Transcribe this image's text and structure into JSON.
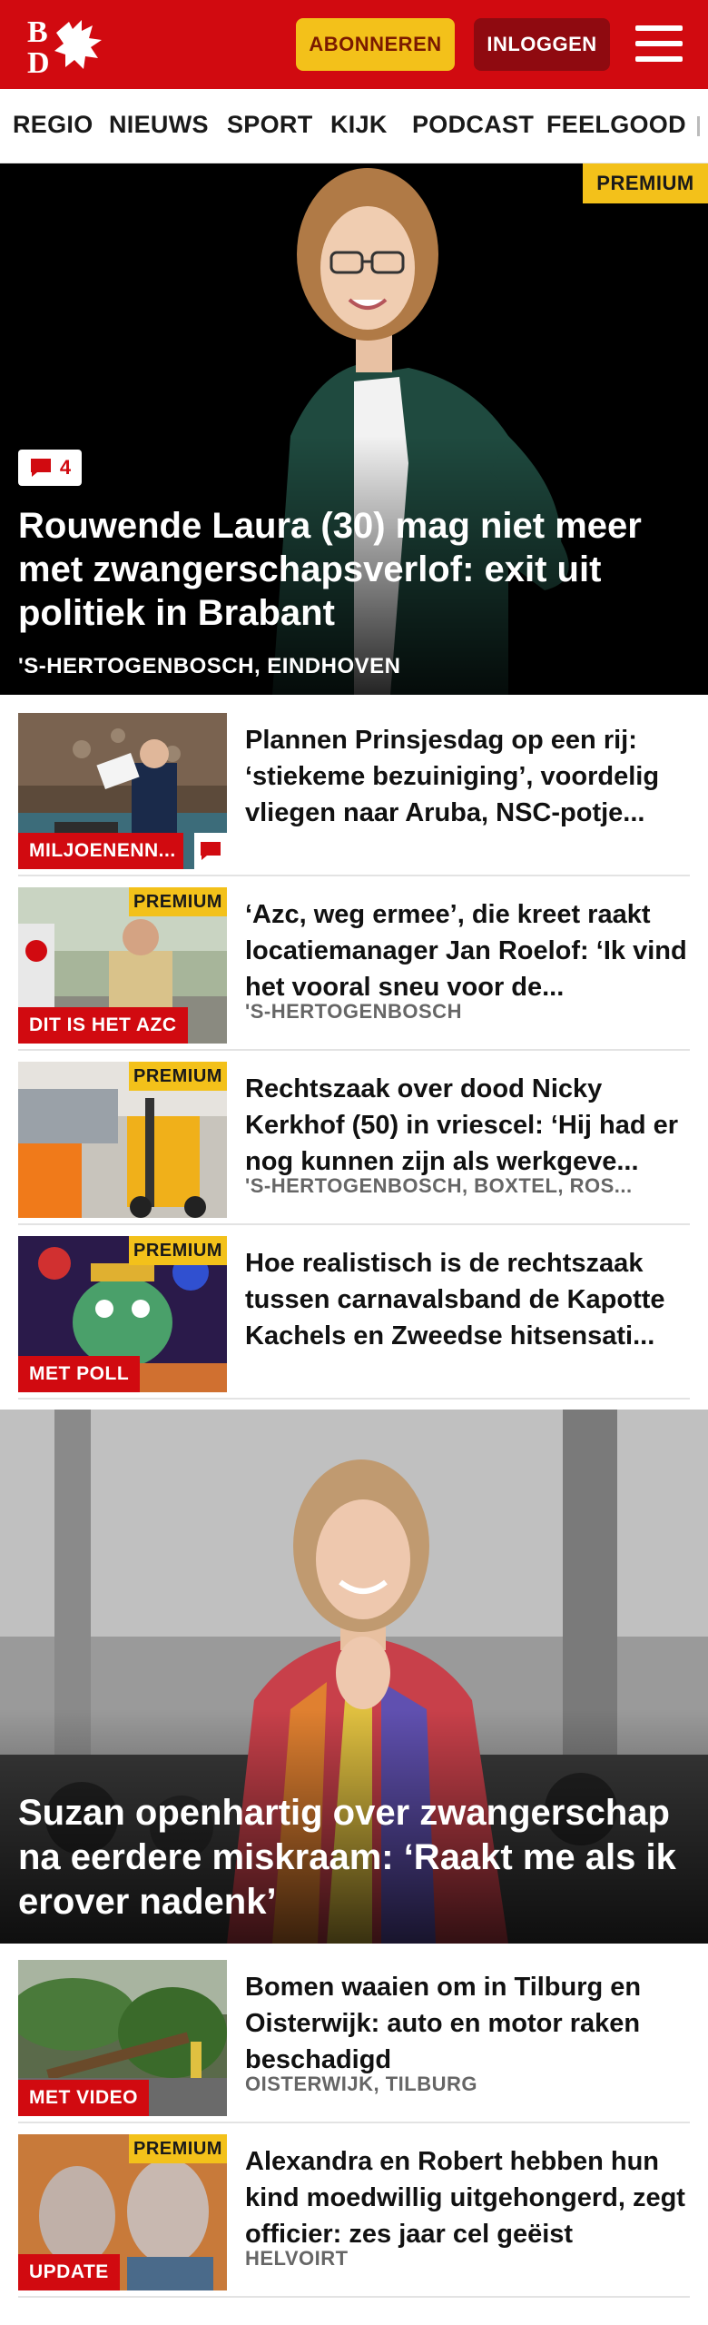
{
  "header": {
    "logo_letters": "BD",
    "subscribe_label": "ABONNEREN",
    "login_label": "INLOGGEN"
  },
  "nav": {
    "items": [
      "REGIO",
      "NIEUWS",
      "SPORT",
      "KIJK",
      "PODCAST",
      "FEELGOOD"
    ]
  },
  "hero": {
    "premium_label": "PREMIUM",
    "comment_count": "4",
    "title": "Rouwende Laura (30) mag niet meer met zwangerschapsverlof: exit uit politiek in Brabant",
    "location": "'S-HERTOGENBOSCH, EINDHOVEN"
  },
  "articles": [
    {
      "title": "Plannen Prinsjesdag op een rij: ‘stiekeme bezuiniging’, voordelig vliegen naar Aruba, NSC-potje...",
      "tag": "MILJOENENN...",
      "location": "",
      "premium": ""
    },
    {
      "title": "‘Azc, weg ermee’, die kreet raakt locatiemanager Jan Roelof: ‘Ik vind het vooral sneu voor de...",
      "tag": "DIT IS HET AZC",
      "location": "'S-HERTOGENBOSCH",
      "premium": "PREMIUM"
    },
    {
      "title": "Rechtszaak over dood Nicky Kerkhof (50) in vriescel: ‘Hij had er nog kunnen zijn als werkgeve...",
      "tag": "",
      "location": "'S-HERTOGENBOSCH, BOXTEL, ROS...",
      "premium": "PREMIUM"
    },
    {
      "title": "Hoe realistisch is de rechtszaak tussen carnavalsband de Kapotte Kachels en Zweedse hitsensati...",
      "tag": "MET POLL",
      "location": "",
      "premium": "PREMIUM"
    }
  ],
  "hero2": {
    "title": "Suzan openhartig over zwangerschap na eerdere miskraam: ‘Raakt me als ik erover nadenk’"
  },
  "articles2": [
    {
      "title": "Bomen waaien om in Tilburg en Oisterwijk: auto en motor raken beschadigd",
      "tag": "MET VIDEO",
      "location": "OISTERWIJK, TILBURG",
      "premium": ""
    },
    {
      "title": "Alexandra en Robert hebben hun kind moedwillig uitgehongerd, zegt officier: zes jaar cel geëist",
      "tag": "UPDATE",
      "location": "HELVOIRT",
      "premium": "PREMIUM"
    }
  ],
  "colors": {
    "brand_red": "#d10a10",
    "premium_yellow": "#f3c11a",
    "login_dark_red": "#8f0a10"
  },
  "icons": [
    "logo-dragon-icon",
    "menu-icon",
    "comment-icon"
  ]
}
